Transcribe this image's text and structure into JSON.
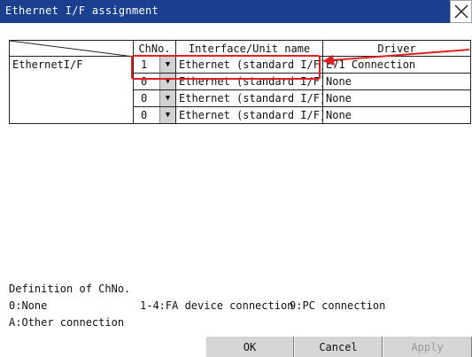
{
  "window": {
    "title": "Ethernet I/F assignment",
    "close_icon": "close-icon"
  },
  "table": {
    "headers": {
      "chno": "ChNo.",
      "interface": "Interface/Unit name",
      "driver": "Driver"
    },
    "group_label": "EthernetI/F",
    "rows": [
      {
        "chno": "1",
        "interface": "Ethernet (standard I/F)",
        "driver": "E71 Connection"
      },
      {
        "chno": "0",
        "interface": "Ethernet (standard I/F)",
        "driver": "None"
      },
      {
        "chno": "0",
        "interface": "Ethernet (standard I/F)",
        "driver": "None"
      },
      {
        "chno": "0",
        "interface": "Ethernet (standard I/F)",
        "driver": "None"
      }
    ],
    "dropdown_icon": "triangle-down-icon"
  },
  "definition": {
    "title": "Definition of ChNo.",
    "none": "0:None",
    "fa": "1-4:FA device connection",
    "pc": "9:PC connection",
    "other": "A:Other connection"
  },
  "buttons": {
    "ok": "OK",
    "cancel": "Cancel",
    "apply": "Apply"
  },
  "colors": {
    "titlebar": "#1b3f8f",
    "highlight": "#e02020"
  }
}
